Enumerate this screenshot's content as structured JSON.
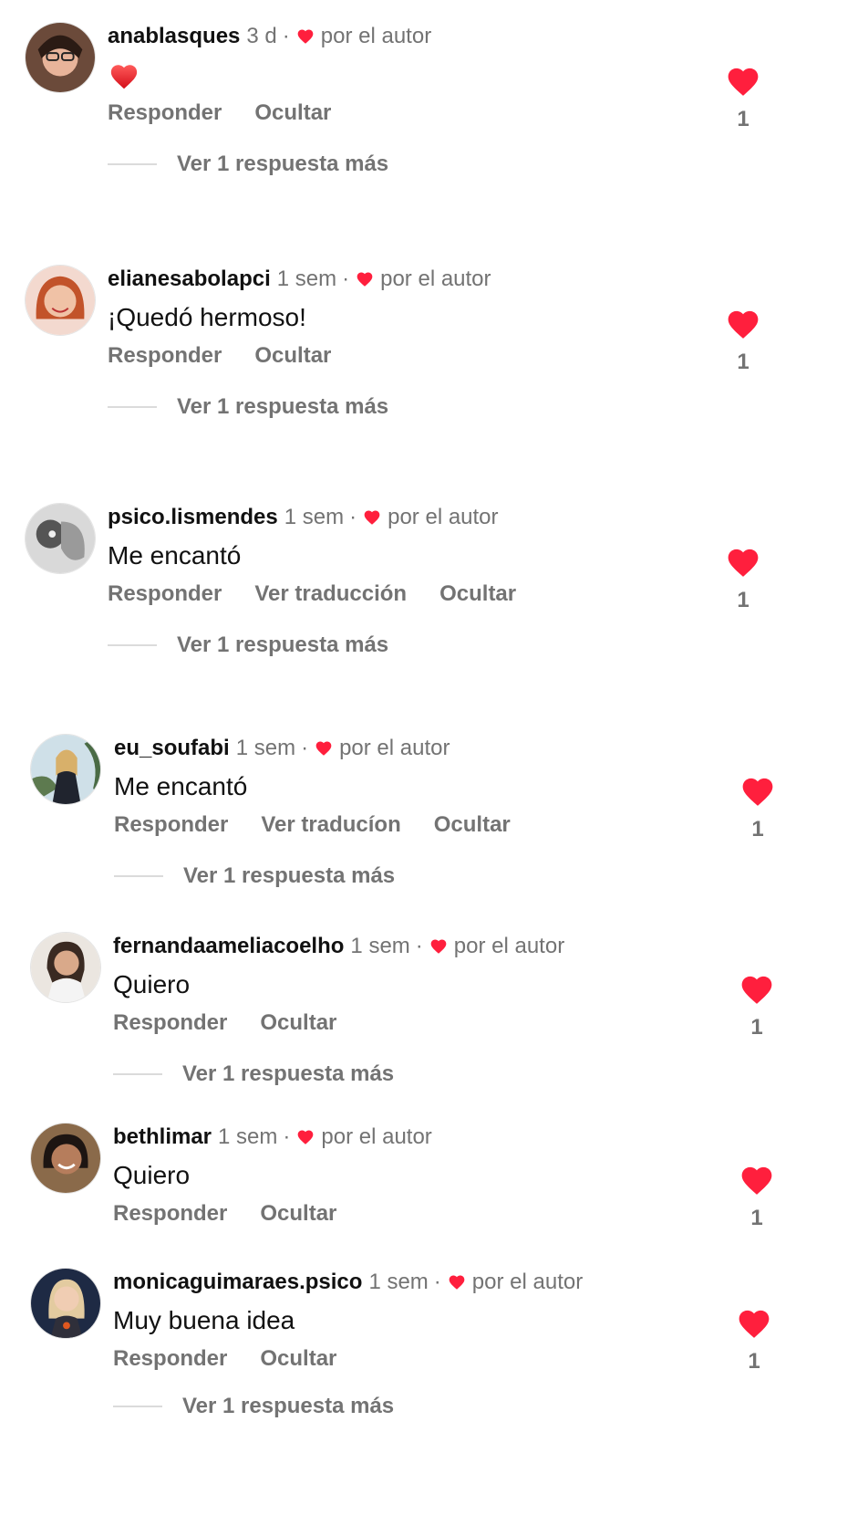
{
  "colors": {
    "heart": "#ff1f3d",
    "muted": "#737373",
    "text": "#111111"
  },
  "labels": {
    "by_author": "por el autor",
    "dot": "·"
  },
  "comments": [
    {
      "username": "anablasques",
      "time": "3 d",
      "text": "",
      "emoji": "red-heart-emoji",
      "actions": [
        "Responder",
        "Ocultar"
      ],
      "replies": "Ver 1 respuesta más",
      "likes": "1"
    },
    {
      "username": "elianesabolapci",
      "time": "1 sem",
      "text": "¡Quedó hermoso!",
      "actions": [
        "Responder",
        "Ocultar"
      ],
      "replies": "Ver 1 respuesta más",
      "likes": "1"
    },
    {
      "username": "psico.lismendes",
      "time": "1 sem",
      "text": "Me encantó",
      "actions": [
        "Responder",
        "Ver traducción",
        "Ocultar"
      ],
      "replies": "Ver 1 respuesta más",
      "likes": "1"
    },
    {
      "username": "eu_soufabi",
      "time": "1 sem",
      "text": "Me encantó",
      "actions": [
        "Responder",
        "Ver traducíon",
        "Ocultar"
      ],
      "replies": "Ver 1 respuesta más",
      "likes": "1"
    },
    {
      "username": "fernandaameliacoelho",
      "time": "1 sem",
      "text": "Quiero",
      "actions": [
        "Responder",
        "Ocultar"
      ],
      "replies": "Ver 1 respuesta más",
      "likes": "1"
    },
    {
      "username": "bethlimar",
      "time": "1 sem",
      "text": "Quiero",
      "actions": [
        "Responder",
        "Ocultar"
      ],
      "replies": "",
      "likes": "1"
    },
    {
      "username": "monicaguimaraes.psico",
      "time": "1 sem",
      "text": "Muy buena idea",
      "actions": [
        "Responder",
        "Ocultar"
      ],
      "replies": "Ver 1 respuesta más",
      "likes": "1"
    }
  ]
}
